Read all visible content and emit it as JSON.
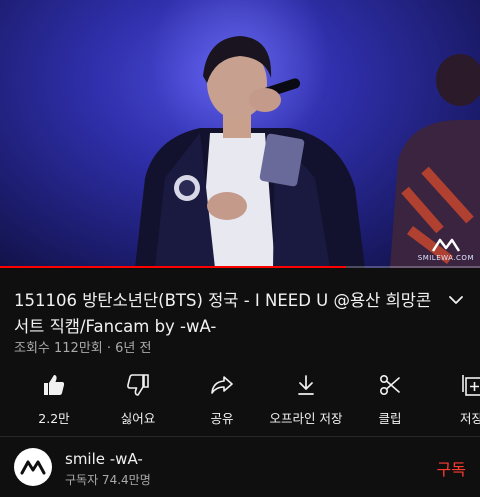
{
  "player": {
    "watermark_text": "SMILEWA.COM",
    "progress_fraction": 0.72,
    "accent_color": "#ff0000"
  },
  "video": {
    "title": "151106 방탄소년단(BTS) 정국 - I NEED U @용산 희망콘서트 직캠/Fancam by -wA-",
    "views": "조회수 112만회",
    "age": "6년 전"
  },
  "actions": [
    {
      "icon": "thumbs-up-icon",
      "label": "2.2만"
    },
    {
      "icon": "thumbs-down-icon",
      "label": "싫어요"
    },
    {
      "icon": "share-icon",
      "label": "공유"
    },
    {
      "icon": "download-icon",
      "label": "오프라인 저장"
    },
    {
      "icon": "scissors-icon",
      "label": "클립"
    },
    {
      "icon": "save-playlist-icon",
      "label": "저장"
    }
  ],
  "channel": {
    "name": "smile -wA-",
    "subscribers": "구독자 74.4만명",
    "subscribe_label": "구독",
    "subscribe_color": "#ff3b30"
  }
}
